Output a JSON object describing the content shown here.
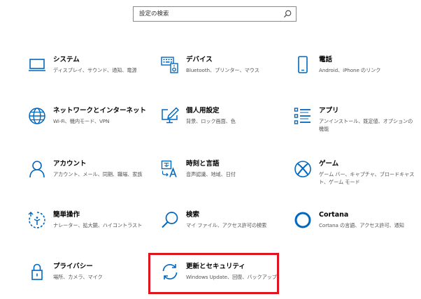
{
  "search": {
    "placeholder": "設定の検索"
  },
  "accent": "#0067c0",
  "highlight_color": "#e0141e",
  "tiles": [
    {
      "icon": "laptop-icon",
      "title": "システム",
      "desc": "ディスプレイ、サウンド、通知、電源"
    },
    {
      "icon": "keyboard-speaker-icon",
      "title": "デバイス",
      "desc": "Bluetooth、プリンター、マウス"
    },
    {
      "icon": "phone-icon",
      "title": "電話",
      "desc": "Android、iPhone のリンク"
    },
    {
      "icon": "globe-icon",
      "title": "ネットワークとインターネット",
      "desc": "Wi-Fi、機内モード、VPN"
    },
    {
      "icon": "pen-monitor-icon",
      "title": "個人用設定",
      "desc": "背景、ロック画面、色"
    },
    {
      "icon": "apps-list-icon",
      "title": "アプリ",
      "desc": "アンインストール、既定値、オプションの機能"
    },
    {
      "icon": "person-icon",
      "title": "アカウント",
      "desc": "アカウント、メール、同期、職場、家族"
    },
    {
      "icon": "time-language-icon",
      "title": "時刻と言語",
      "desc": "音声認識、地域、日付"
    },
    {
      "icon": "xbox-icon",
      "title": "ゲーム",
      "desc": "ゲーム バー、キャプチャ、ブロードキャスト、ゲーム モード"
    },
    {
      "icon": "ease-of-access-icon",
      "title": "簡単操作",
      "desc": "ナレーター、拡大鏡、ハイコントラスト"
    },
    {
      "icon": "search-magnifier-icon",
      "title": "検索",
      "desc": "マイ ファイル、アクセス許可の検索"
    },
    {
      "icon": "cortana-icon",
      "title": "Cortana",
      "desc": "Cortana の言語、アクセス許可、通知"
    },
    {
      "icon": "lock-icon",
      "title": "プライバシー",
      "desc": "場所、カメラ、マイク"
    },
    {
      "icon": "update-sync-icon",
      "title": "更新とセキュリティ",
      "desc": "Windows Update、回復、バックアップ"
    }
  ]
}
